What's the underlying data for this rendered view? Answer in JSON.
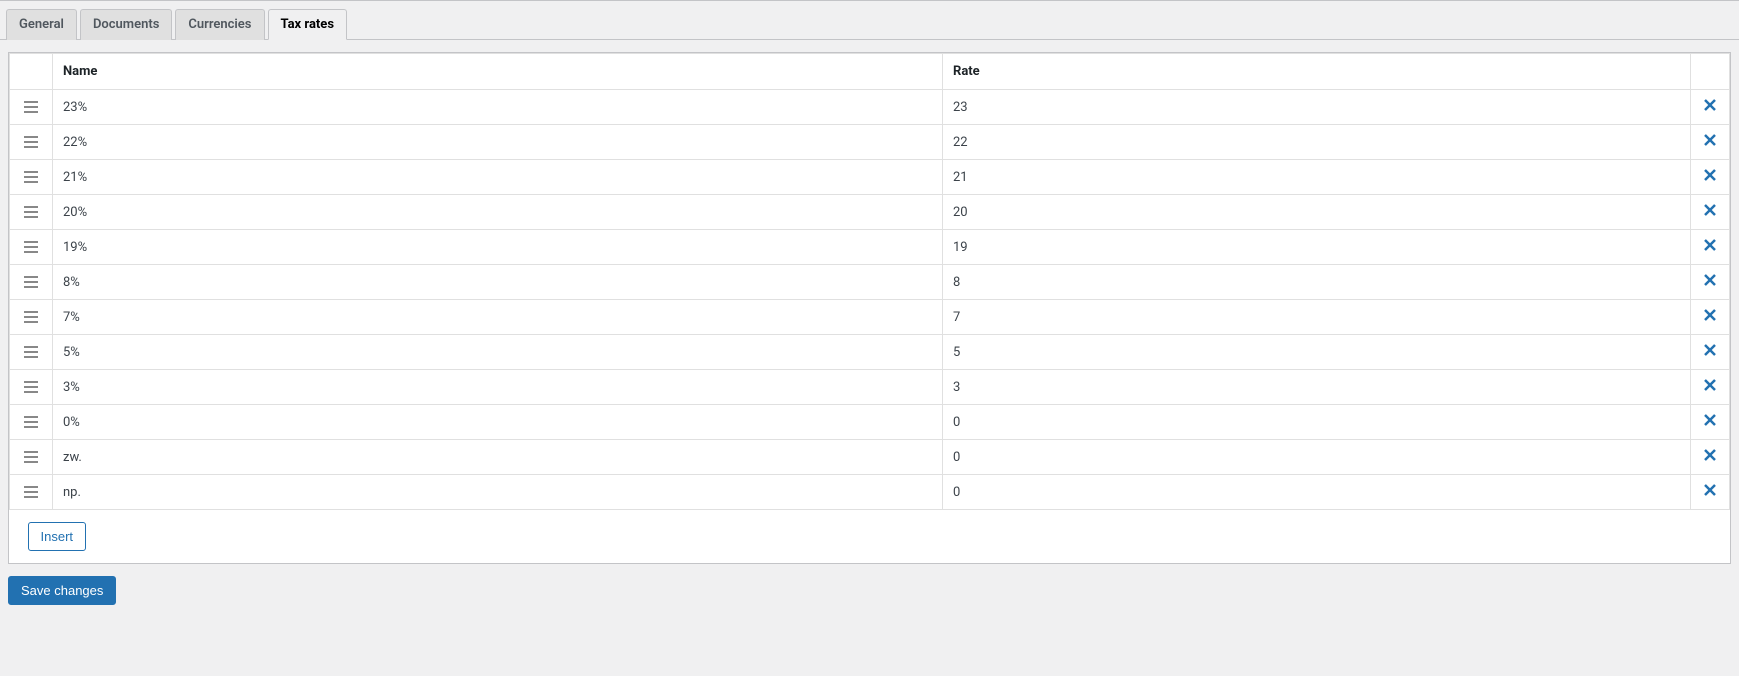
{
  "tabs": {
    "items": [
      {
        "label": "General",
        "active": false
      },
      {
        "label": "Documents",
        "active": false
      },
      {
        "label": "Currencies",
        "active": false
      },
      {
        "label": "Tax rates",
        "active": true
      }
    ]
  },
  "table": {
    "headers": {
      "name": "Name",
      "rate": "Rate"
    },
    "rows": [
      {
        "name": "23%",
        "rate": "23"
      },
      {
        "name": "22%",
        "rate": "22"
      },
      {
        "name": "21%",
        "rate": "21"
      },
      {
        "name": "20%",
        "rate": "20"
      },
      {
        "name": "19%",
        "rate": "19"
      },
      {
        "name": "8%",
        "rate": "8"
      },
      {
        "name": "7%",
        "rate": "7"
      },
      {
        "name": "5%",
        "rate": "5"
      },
      {
        "name": "3%",
        "rate": "3"
      },
      {
        "name": "0%",
        "rate": "0"
      },
      {
        "name": "zw.",
        "rate": "0"
      },
      {
        "name": "np.",
        "rate": "0"
      }
    ]
  },
  "buttons": {
    "insert": "Insert",
    "save": "Save changes"
  },
  "icons": {
    "drag": "drag-handle-icon",
    "delete": "close-icon"
  }
}
